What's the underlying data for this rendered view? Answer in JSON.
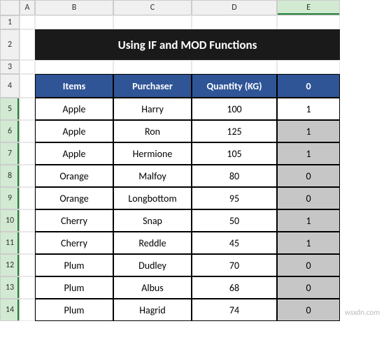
{
  "columns": [
    "A",
    "B",
    "C",
    "D",
    "E"
  ],
  "rows": [
    "1",
    "2",
    "3",
    "4",
    "5",
    "6",
    "7",
    "8",
    "9",
    "10",
    "11",
    "12",
    "13",
    "14"
  ],
  "title": "Using  IF and MOD Functions",
  "headers": {
    "items": "Items",
    "purchaser": "Purchaser",
    "quantity": "Quantity (KG)",
    "e": "0"
  },
  "data": [
    {
      "item": "Apple",
      "purchaser": "Harry",
      "qty": "100",
      "e": "1",
      "shaded": false
    },
    {
      "item": "Apple",
      "purchaser": "Ron",
      "qty": "125",
      "e": "1",
      "shaded": true
    },
    {
      "item": "Apple",
      "purchaser": "Hermione",
      "qty": "105",
      "e": "1",
      "shaded": true
    },
    {
      "item": "Orange",
      "purchaser": "Malfoy",
      "qty": "80",
      "e": "0",
      "shaded": true
    },
    {
      "item": "Orange",
      "purchaser": "Longbottom",
      "qty": "95",
      "e": "0",
      "shaded": true
    },
    {
      "item": "Cherry",
      "purchaser": "Snap",
      "qty": "50",
      "e": "1",
      "shaded": true
    },
    {
      "item": "Cherry",
      "purchaser": "Reddle",
      "qty": "45",
      "e": "1",
      "shaded": true
    },
    {
      "item": "Plum",
      "purchaser": "Dudley",
      "qty": "70",
      "e": "0",
      "shaded": true
    },
    {
      "item": "Plum",
      "purchaser": "Albus",
      "qty": "68",
      "e": "0",
      "shaded": true
    },
    {
      "item": "Plum",
      "purchaser": "Hagrid",
      "qty": "74",
      "e": "0",
      "shaded": true
    }
  ],
  "watermark": "wsxdn.com"
}
